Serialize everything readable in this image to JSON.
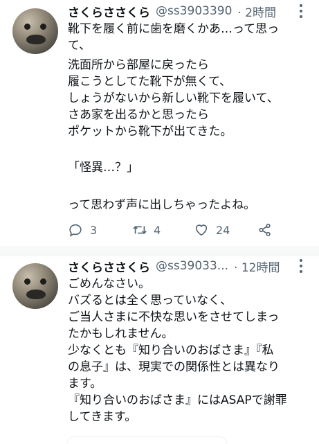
{
  "tweets": [
    {
      "display_name": "さくらささくら",
      "handle": "@ss3903390",
      "time": "· 2時間",
      "lines": [
        "靴下を履く前に歯を磨くかあ…って思っ",
        "て、",
        "洗面所から部屋に戻ったら",
        "履こうとしてた靴下が無くて、",
        "しょうがないから新しい靴下を履いて、",
        "さあ家を出るかと思ったら",
        "ポケットから靴下が出てきた。",
        "",
        "「怪異…？」",
        "",
        "って思わず声に出しちゃったよね。"
      ],
      "replies": "3",
      "retweets": "4",
      "likes": "24"
    },
    {
      "display_name": "さくらささくら",
      "handle": "@ss39033...",
      "time": "· 12時間",
      "lines": [
        "ごめんなさい。",
        "バズるとは全く思っていなく、",
        "ご当人さまに不快な思いをさせてしまっ",
        "たかもしれません。",
        "少なくとも『知り合いのおばさま』『私",
        "の息子』は、現実での関係性とは異なり",
        "ます。",
        "『知り合いのおばさま』にはASAPで謝罪",
        "してきます。"
      ]
    }
  ],
  "icons": {
    "reply": "reply-icon",
    "retweet": "retweet-icon",
    "like": "heart-icon",
    "share": "share-icon",
    "more": "more-vertical-icon"
  },
  "colors": {
    "text": "#0f1419",
    "secondary": "#536471",
    "separator": "#f7f9f9"
  }
}
